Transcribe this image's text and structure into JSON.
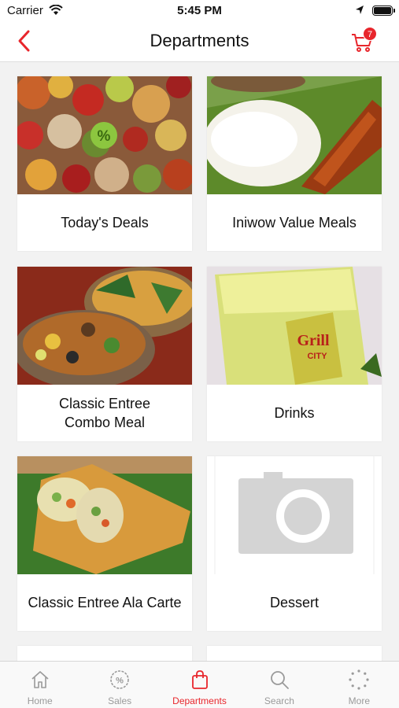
{
  "status_bar": {
    "carrier": "Carrier",
    "time": "5:45 PM"
  },
  "header": {
    "title": "Departments",
    "cart_count": "7"
  },
  "colors": {
    "accent": "#e8262c",
    "inactive": "#9a9a9a"
  },
  "departments": [
    {
      "label": "Today's Deals",
      "image": "vegetables-photo"
    },
    {
      "label": "Iniwow Value Meals",
      "image": "rice-bbq-photo"
    },
    {
      "label": "Classic Entree\nCombo Meal",
      "image": "stew-bowls-photo"
    },
    {
      "label": "Drinks",
      "image": "juice-cup-photo"
    },
    {
      "label": "Classic Entree Ala Carte",
      "image": "lumpia-photo"
    },
    {
      "label": "Dessert",
      "image": "camera-placeholder-icon"
    }
  ],
  "tabs": [
    {
      "label": "Home",
      "icon": "home-icon",
      "active": false
    },
    {
      "label": "Sales",
      "icon": "sales-icon",
      "active": false
    },
    {
      "label": "Departments",
      "icon": "shopping-bag-icon",
      "active": true
    },
    {
      "label": "Search",
      "icon": "search-icon",
      "active": false
    },
    {
      "label": "More",
      "icon": "more-icon",
      "active": false
    }
  ]
}
